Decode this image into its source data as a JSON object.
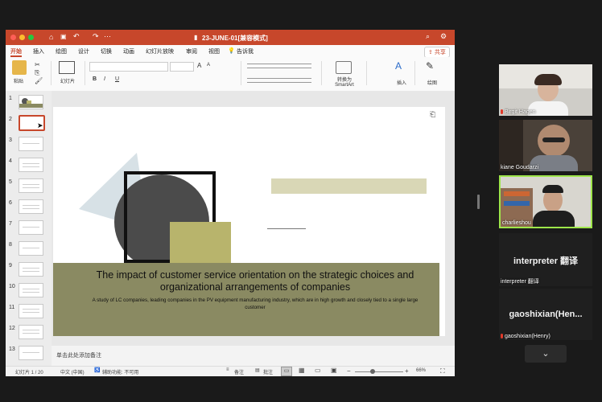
{
  "window": {
    "title": "23-JUNE-01[兼容模式]"
  },
  "menu": {
    "items": [
      "开始",
      "插入",
      "绘图",
      "设计",
      "切换",
      "动画",
      "幻灯片放映",
      "审阅",
      "视图"
    ],
    "tell_me": "告诉我",
    "share": "共享"
  },
  "ribbon": {
    "paste": "粘贴",
    "new_slide": "幻灯片",
    "convert_smartart": "转换为 SmartArt",
    "insert": "插入",
    "draw": "绘图",
    "font_size_grow": "A",
    "font_size_shrink": "A",
    "bold": "B",
    "italic": "I",
    "underline": "U"
  },
  "thumbnails": {
    "numbers": [
      "1",
      "2",
      "3",
      "4",
      "5",
      "6",
      "7",
      "8",
      "9",
      "10",
      "11",
      "12",
      "13"
    ],
    "selected_index": 2
  },
  "slide": {
    "title": "The impact of customer service orientation on the strategic choices and organizational arrangements of companies",
    "subtitle": "A study of LC companies, leading companies in the PV equipment manufacturing industry, which are in high growth and closely tied to a single large customer",
    "colors": {
      "band": "#8a8a62",
      "box": "#d9d7b6",
      "square": "#b8b46c",
      "circle": "#4b4b4b",
      "triangle": "#d7e1e6"
    }
  },
  "notes": {
    "placeholder": "单击此处添加备注"
  },
  "status": {
    "slide_counter": "幻灯片 1 / 20",
    "language": "中文 (中国)",
    "accessibility": "辅助功能: 不可用",
    "notes_btn": "备注",
    "comments_btn": "批注",
    "zoom": "66%"
  },
  "participants": [
    {
      "name": "Birgit Hagen",
      "muted": true
    },
    {
      "name": "kiane Goudarzi",
      "muted": false
    },
    {
      "name": "charlieshou",
      "muted": false,
      "active": true
    },
    {
      "display": "interpreter 翻译",
      "name": "interpreter 翻译",
      "muted": false
    },
    {
      "display": "gaoshixian(Hen...",
      "name": "gaoshixian(Henry)",
      "muted": true
    }
  ],
  "icons": {
    "paste": "clipboard-icon",
    "search": "search-icon",
    "share": "share-icon",
    "chevron": "chevron-down-icon"
  }
}
